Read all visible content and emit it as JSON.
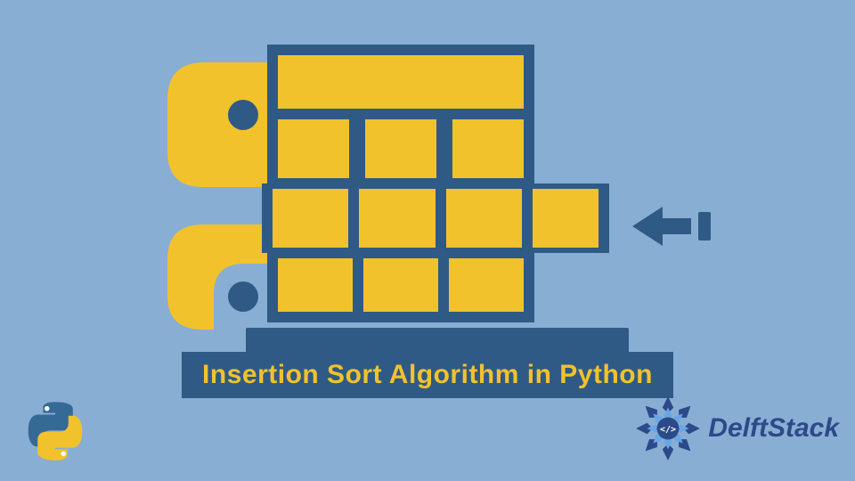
{
  "title": "Insertion Sort Algorithm in Python",
  "brand": {
    "name": "DelftStack"
  },
  "colors": {
    "background": "#89aed3",
    "accent_yellow": "#f2c22c",
    "accent_blue": "#2f5a85",
    "brand_blue": "#2c4a8a"
  },
  "diagram": {
    "grid": {
      "header_cells": 1,
      "row1_cells": 3,
      "row2_cells": 4,
      "row3_cells": 3
    },
    "arrow_direction": "left",
    "python_logo_colors": [
      "#f2c22c",
      "#2f5a85"
    ]
  },
  "icons": {
    "main": "python-grid-insertion-icon",
    "corner": "python-logo-icon",
    "brand": "delftstack-mandala-icon",
    "arrow": "arrow-left-icon"
  }
}
